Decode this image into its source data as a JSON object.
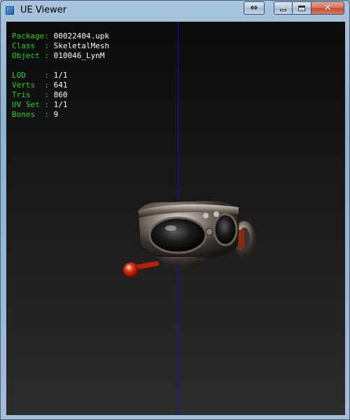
{
  "window": {
    "title": "UE Viewer",
    "buttons": {
      "resize": "⇔",
      "close": "✕"
    }
  },
  "info": {
    "package": {
      "key": "Package:",
      "value": "00022404.upk"
    },
    "class": {
      "key": "Class  :",
      "value": "SkeletalMesh"
    },
    "object": {
      "key": "Object :",
      "value": "010046_LynM"
    },
    "lod": {
      "key": "LOD    :",
      "value": "1/1"
    },
    "verts": {
      "key": "Verts  :",
      "value": "641"
    },
    "tris": {
      "key": "Tris   :",
      "value": "860"
    },
    "uvset": {
      "key": "UV Set :",
      "value": "1/1"
    },
    "bones": {
      "key": "Bones  :",
      "value": "9"
    }
  },
  "colors": {
    "label": "#28d428",
    "value": "#ffffff",
    "axis": "#1414b8",
    "background": "#1a1a1a"
  }
}
